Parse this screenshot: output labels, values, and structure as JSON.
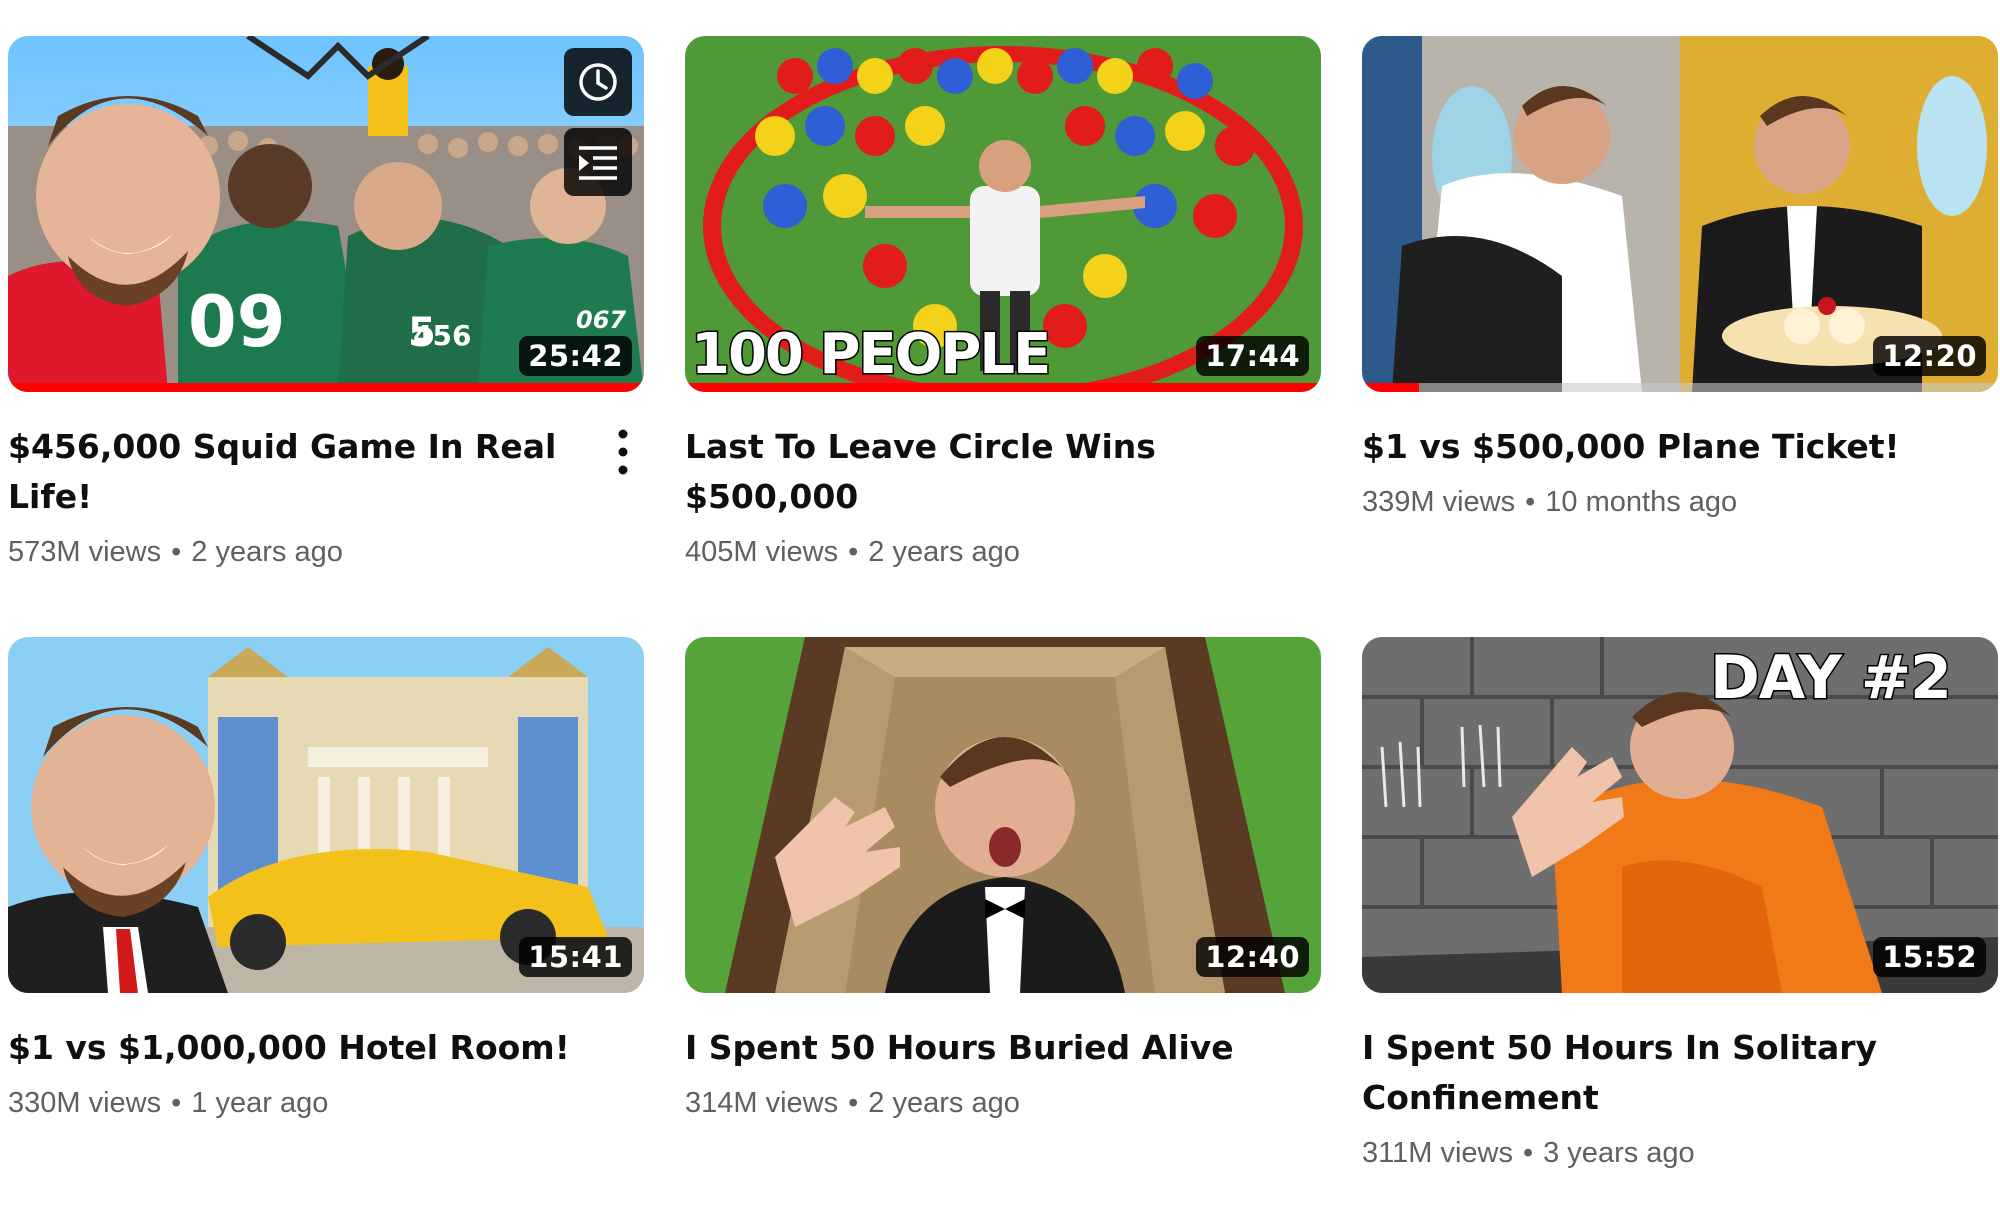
{
  "videos": [
    {
      "title": "$456,000 Squid Game In Real Life!",
      "views": "573M views",
      "age": "2 years ago",
      "duration": "25:42",
      "watched_fraction": 1.0,
      "thumb_text": [
        "456",
        "067"
      ],
      "hover_icons": [
        "watch-later-icon",
        "add-to-queue-icon"
      ],
      "menu_icon": "more-vert-icon"
    },
    {
      "title": "Last To Leave Circle Wins $500,000",
      "views": "405M views",
      "age": "2 years ago",
      "duration": "17:44",
      "watched_fraction": 1.0,
      "thumb_text": [
        "100 PEOPLE"
      ]
    },
    {
      "title": "$1 vs $500,000 Plane Ticket!",
      "views": "339M views",
      "age": "10 months ago",
      "duration": "12:20",
      "watched_fraction": 0.09
    },
    {
      "title": "$1 vs $1,000,000 Hotel Room!",
      "views": "330M views",
      "age": "1 year ago",
      "duration": "15:41"
    },
    {
      "title": "I Spent 50 Hours Buried Alive",
      "views": "314M views",
      "age": "2 years ago",
      "duration": "12:40"
    },
    {
      "title": "I Spent 50 Hours In Solitary Confinement",
      "views": "311M views",
      "age": "3 years ago",
      "duration": "15:52",
      "thumb_text": [
        "DAY #2"
      ]
    }
  ],
  "separator": "•",
  "colors": {
    "progress": "#ff0000",
    "meta_text": "#606060",
    "title_text": "#0f0f0f"
  }
}
